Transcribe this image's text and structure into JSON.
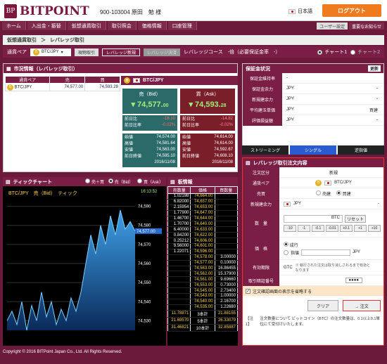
{
  "header": {
    "logo_badge": "BP",
    "logo_text": "BITPOINT",
    "account": "900-103004  原田　勉 様",
    "lang": "日本語",
    "logout": "ログアウト"
  },
  "nav": {
    "items": [
      "ホーム",
      "入出金・振替",
      "仮想通貨取引",
      "取引照会",
      "価格情報",
      "口座管理"
    ],
    "user_setting": "ユーザー設定",
    "notice": "重要なお知らせ"
  },
  "crumb": {
    "a": "仮想通貨取引",
    "b": "レバレッジ取引"
  },
  "pairbar": {
    "label": "通貨ペア",
    "pair": "BTC/JPY",
    "b1": "現物取引",
    "b2": "レバレッジ新規",
    "b3": "レバレッジ決済",
    "course": "レバレッジコース　-倍（必要保証金率　-）",
    "chart1": "チャート1",
    "chart2": "チャート2"
  },
  "market": {
    "title": "市況情報（レバレッジ取引）",
    "cols": [
      "通貨ペア",
      "売",
      "買"
    ],
    "row": {
      "pair": "BTC/JPY",
      "sell": "74,577.00",
      "buy": "74,593.28"
    }
  },
  "rates": {
    "pair": "BTC/JPY",
    "bid_label": "売（Bid）",
    "ask_label": "買（Ask）",
    "bid_main": "74,577.",
    "bid_dec": "00",
    "ask_main": "74,593.",
    "ask_dec": "28",
    "bid_diff_label": "前日比",
    "bid_diff": "-18.10",
    "bid_pct_label": "前日比率",
    "bid_pct": "-0.02%",
    "ask_diff_label": "前日比",
    "ask_diff": "-14.82",
    "ask_pct_label": "前日比率",
    "ask_pct": "-0.02%",
    "bid_stats": [
      [
        "始値",
        "74,574.00"
      ],
      [
        "高値",
        "74,581.64"
      ],
      [
        "安値",
        "74,563.00"
      ],
      [
        "前日終値",
        "74,595.10"
      ]
    ],
    "ask_stats": [
      [
        "始値",
        "74,614.00"
      ],
      [
        "高値",
        "74,614.00"
      ],
      [
        "安値",
        "74,592.67"
      ],
      [
        "前日終値",
        "74,608.10"
      ]
    ],
    "date": "2016/11/08"
  },
  "tick": {
    "title": "ティックチャート",
    "opt1": "売＋買",
    "opt2": "売（Bid）",
    "opt3": "買（Ask）",
    "label": "BTC/JPY　売（Bid）　ティック",
    "time": "16:13:52",
    "current": "74,577.00"
  },
  "chart_data": {
    "type": "line",
    "series": [
      {
        "values": [
          74530,
          74535,
          74528,
          74540,
          74525,
          74538,
          74530,
          74545,
          74532,
          74540,
          74528,
          74536,
          74530,
          74542,
          74535,
          74545,
          74560,
          74575,
          74565,
          74580,
          74570,
          74585,
          74575,
          74588,
          74578,
          74582,
          74577
        ]
      }
    ],
    "yticks": [
      "74,590",
      "74,580",
      "74,570",
      "74,560",
      "74,550",
      "74,540",
      "74,530"
    ],
    "ylim": [
      74525,
      74595
    ]
  },
  "orderbook": {
    "title": "板情報",
    "cols": [
      "売数量",
      "価格",
      "買数量"
    ],
    "rows": [
      [
        "1.02198",
        "74,664.00",
        ""
      ],
      [
        "6.82000",
        "74,657.00",
        ""
      ],
      [
        "2.15954",
        "74,653.00",
        ""
      ],
      [
        "1.77900",
        "74,647.00",
        ""
      ],
      [
        "1.46700",
        "74,644.00",
        ""
      ],
      [
        "1.70700",
        "74,640.00",
        ""
      ],
      [
        "6.40000",
        "74,633.00",
        ""
      ],
      [
        "0.84200",
        "74,622.00",
        ""
      ],
      [
        "0.25212",
        "74,606.00",
        ""
      ],
      [
        "9.56000",
        "74,601.00",
        ""
      ],
      [
        "1.22071",
        "74,596.00",
        ""
      ],
      [
        "",
        "74,578.00",
        "3.00000"
      ],
      [
        "",
        "74,577.00",
        "0.10000"
      ],
      [
        "",
        "74,563.00",
        "16.86455"
      ],
      [
        "",
        "74,562.00",
        "15.37900"
      ],
      [
        "",
        "74,561.00",
        "9.69660"
      ],
      [
        "",
        "74,553.00",
        "0.73000"
      ],
      [
        "",
        "74,545.00",
        "2.73400"
      ],
      [
        "",
        "74,543.00",
        "1.00000"
      ],
      [
        "",
        "74,540.00",
        "2.16700"
      ],
      [
        "",
        "74,535.00",
        "1.22680"
      ]
    ],
    "summary": [
      [
        "11.78871",
        "3本計",
        "21.88155"
      ],
      [
        "21.69570",
        "5本計",
        "26.33079"
      ],
      [
        "31.46821",
        "10本計",
        "32.85887"
      ]
    ]
  },
  "margin": {
    "title": "保証金状況",
    "update": "更新",
    "rows": [
      [
        "保証金維持率",
        "-",
        ""
      ],
      [
        "保証金余力",
        "JPY",
        "-"
      ],
      [
        "新規建余力",
        "JPY",
        "-"
      ],
      [
        "平均建玉単価",
        "JPY",
        "買建"
      ],
      [
        "評価損益額",
        "JPY",
        "-"
      ]
    ]
  },
  "tabs": {
    "stream": "ストリーミング",
    "single": "シングル",
    "board": "逆指値"
  },
  "form": {
    "title": "レバレッジ取引注文内容",
    "kind_label": "注文区分",
    "kind": "新規",
    "pair_label": "通貨ペア",
    "pair": "BTC/JPY",
    "side_label": "売買",
    "sell": "売建",
    "buy": "買建",
    "avail_label": "新規建余力",
    "avail_cur": "JPY",
    "avail": "-",
    "qty_label": "数　量",
    "qty_unit": "BTC",
    "reset": "リセット",
    "steps": [
      "-10",
      "-1",
      "-0.1",
      "-0.01",
      "+0.1",
      "+1",
      "+10"
    ],
    "price_label": "価　格",
    "market": "成行",
    "limit": "指値",
    "limit_unit": "JPY",
    "exp_label": "有効期限",
    "exp": "GTC",
    "exp_note": "※ 執行された注文は取り消しされるまで有効となります",
    "pin_label": "取引暗証番号",
    "pin": "●●●●",
    "confirm": "注文確認画面の表示を省略する",
    "clear": "クリア",
    "order": "→ 注文",
    "note_label": "【注1】",
    "note": "注文数量について ビットコイン（BTC）の注文数量は、0.1以上0.1単位にて受付けいたします。"
  },
  "footer": "Copyright © 2016 BITPoint Japan Co., Ltd. All Rights Reserved.",
  "colors": {
    "brand": "#7a1e45",
    "bid": "#2a6b6a",
    "ask": "#7a1e2a",
    "orange": "#f07a1e"
  }
}
